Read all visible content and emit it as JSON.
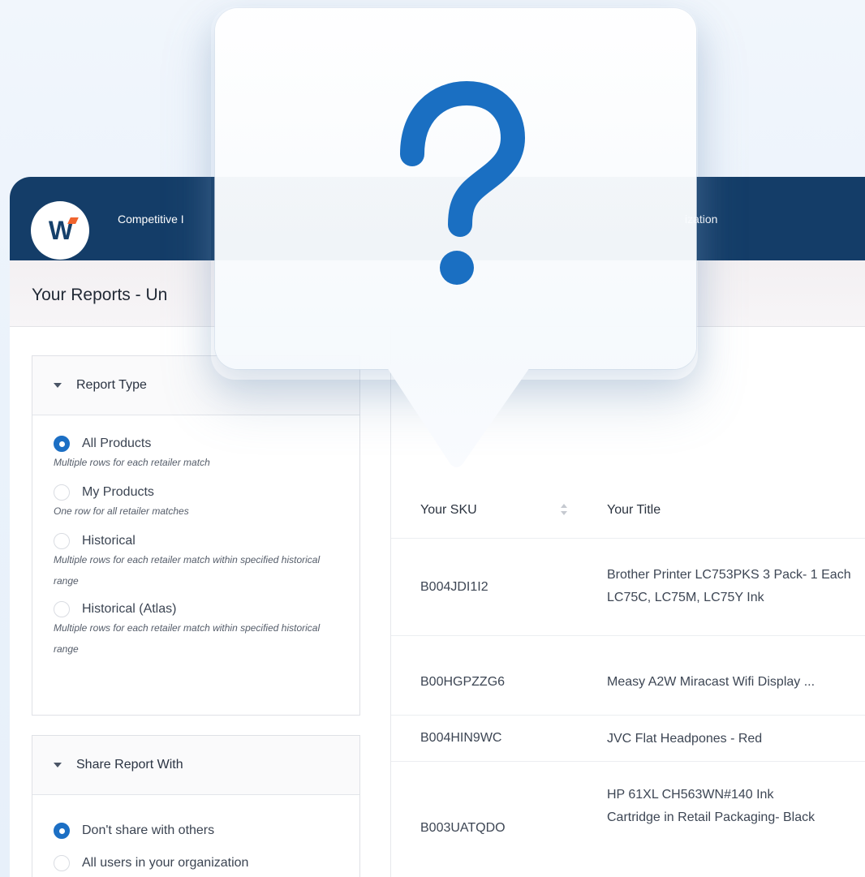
{
  "nav": {
    "logo_letter": "W",
    "competitive_label": "Competitive I",
    "org_label": "ization"
  },
  "page": {
    "title": "Your Reports - Un"
  },
  "report_type": {
    "heading": "Report Type",
    "options": [
      {
        "label": "All Products",
        "desc": "Multiple rows for each retailer match",
        "selected": true
      },
      {
        "label": "My Products",
        "desc": "One row for all retailer matches",
        "selected": false
      },
      {
        "label": "Historical",
        "desc": "Multiple rows for each retailer match within specified historical range",
        "selected": false
      },
      {
        "label": "Historical (Atlas)",
        "desc": "Multiple rows for each retailer match within specified historical range",
        "selected": false
      }
    ]
  },
  "share": {
    "heading": "Share Report With",
    "options": [
      {
        "label": "Don't share with others",
        "selected": true
      },
      {
        "label": "All users in your organization",
        "selected": false
      }
    ]
  },
  "table": {
    "headers": {
      "sku": "Your SKU",
      "title": "Your Title"
    },
    "rows": [
      {
        "sku": "B004JDI1I2",
        "title": "Brother Printer LC753PKS 3 Pack- 1 Each LC75C, LC75M, LC75Y Ink"
      },
      {
        "sku": "B00HGPZZG6",
        "title": "Measy A2W Miracast Wifi Display ..."
      },
      {
        "sku": "B004HIN9WC",
        "title": "JVC Flat Headpones - Red"
      },
      {
        "sku": "B003UATQDO",
        "title": "HP 61XL CH563WN#140 Ink Cartridge in Retail Packaging- Black"
      }
    ]
  },
  "popup": {
    "icon": "question-mark-icon",
    "color": "#1a6fc2"
  }
}
